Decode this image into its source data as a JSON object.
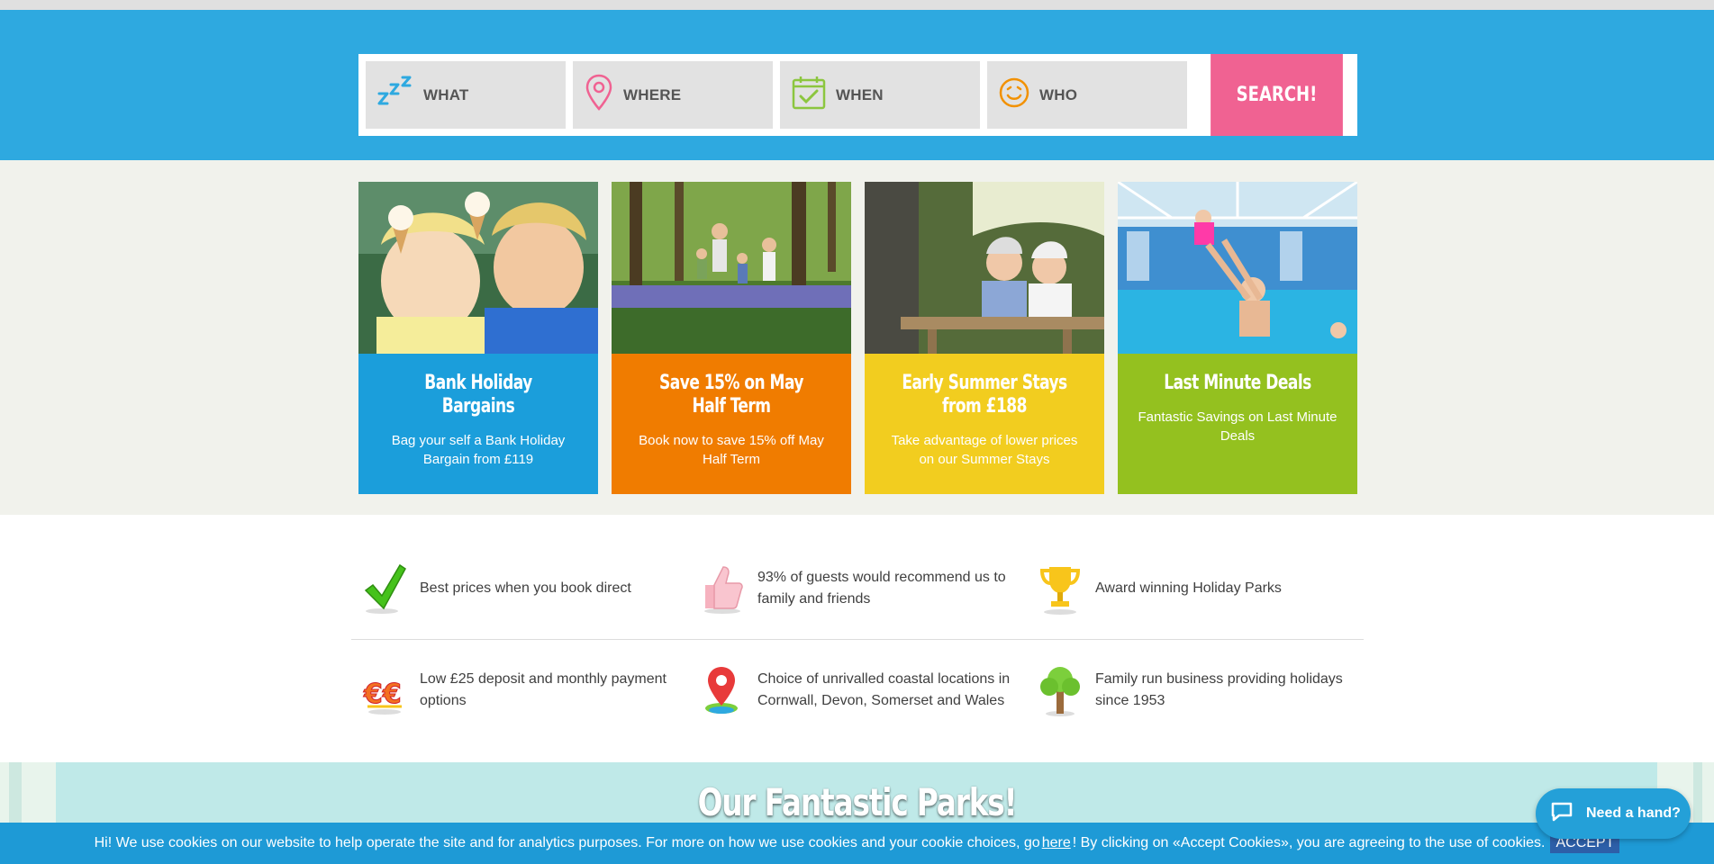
{
  "search": {
    "fields": [
      {
        "label": "WHAT",
        "icon": "sleep-zzz-icon",
        "color": "#2ea9e0"
      },
      {
        "label": "WHERE",
        "icon": "map-pin-icon",
        "color": "#f06292"
      },
      {
        "label": "WHEN",
        "icon": "calendar-check-icon",
        "color": "#8cc63f"
      },
      {
        "label": "WHO",
        "icon": "smiley-face-icon",
        "color": "#f29100"
      }
    ],
    "button_label": "SEARCH!",
    "button_color": "#f06292"
  },
  "offers": [
    {
      "title": "Bank Holiday Bargains",
      "text": "Bag your self a Bank Holiday Bargain from £119",
      "color": "#1b9edb",
      "photo": "children-eating-ice-cream"
    },
    {
      "title": "Save 15% on May Half Term",
      "text": "Book now to save 15% off May Half Term",
      "color": "#f07c00",
      "photo": "family-walking-bluebell-wood"
    },
    {
      "title": "Early Summer Stays from £188",
      "text": "Take advantage of lower prices on our Summer Stays",
      "color": "#f2cd1f",
      "photo": "couple-at-picnic-bench"
    },
    {
      "title": "Last Minute Deals",
      "text": "Fantastic Savings on Last Minute Deals",
      "color": "#94c11f",
      "photo": "family-in-swimming-pool"
    }
  ],
  "usps": [
    {
      "text": "Best prices when you book direct",
      "icon": "green-tick-icon"
    },
    {
      "text": "93% of guests would recommend us to family and friends",
      "icon": "thumbs-up-icon"
    },
    {
      "text": "Award winning Holiday Parks",
      "icon": "trophy-icon"
    },
    {
      "text": "Low £25 deposit and monthly payment options",
      "icon": "pound-coins-icon"
    },
    {
      "text": "Choice of unrivalled coastal locations in Cornwall, Devon, Somerset and Wales",
      "icon": "location-pin-icon"
    },
    {
      "text": "Family run business providing holidays since 1953",
      "icon": "tree-icon"
    }
  ],
  "parks": {
    "title": "Our Fantastic Parks!"
  },
  "cookie": {
    "text_before": "Hi! We use cookies on our website to help operate the site and for analytics purposes. For more on how we use cookies and your cookie choices, go",
    "link_text": "here",
    "text_after": "! By clicking on «Accept Cookies», you are agreeing to the use of cookies.",
    "accept_label": "ACCEPT"
  },
  "chat": {
    "label": "Need a hand?"
  }
}
